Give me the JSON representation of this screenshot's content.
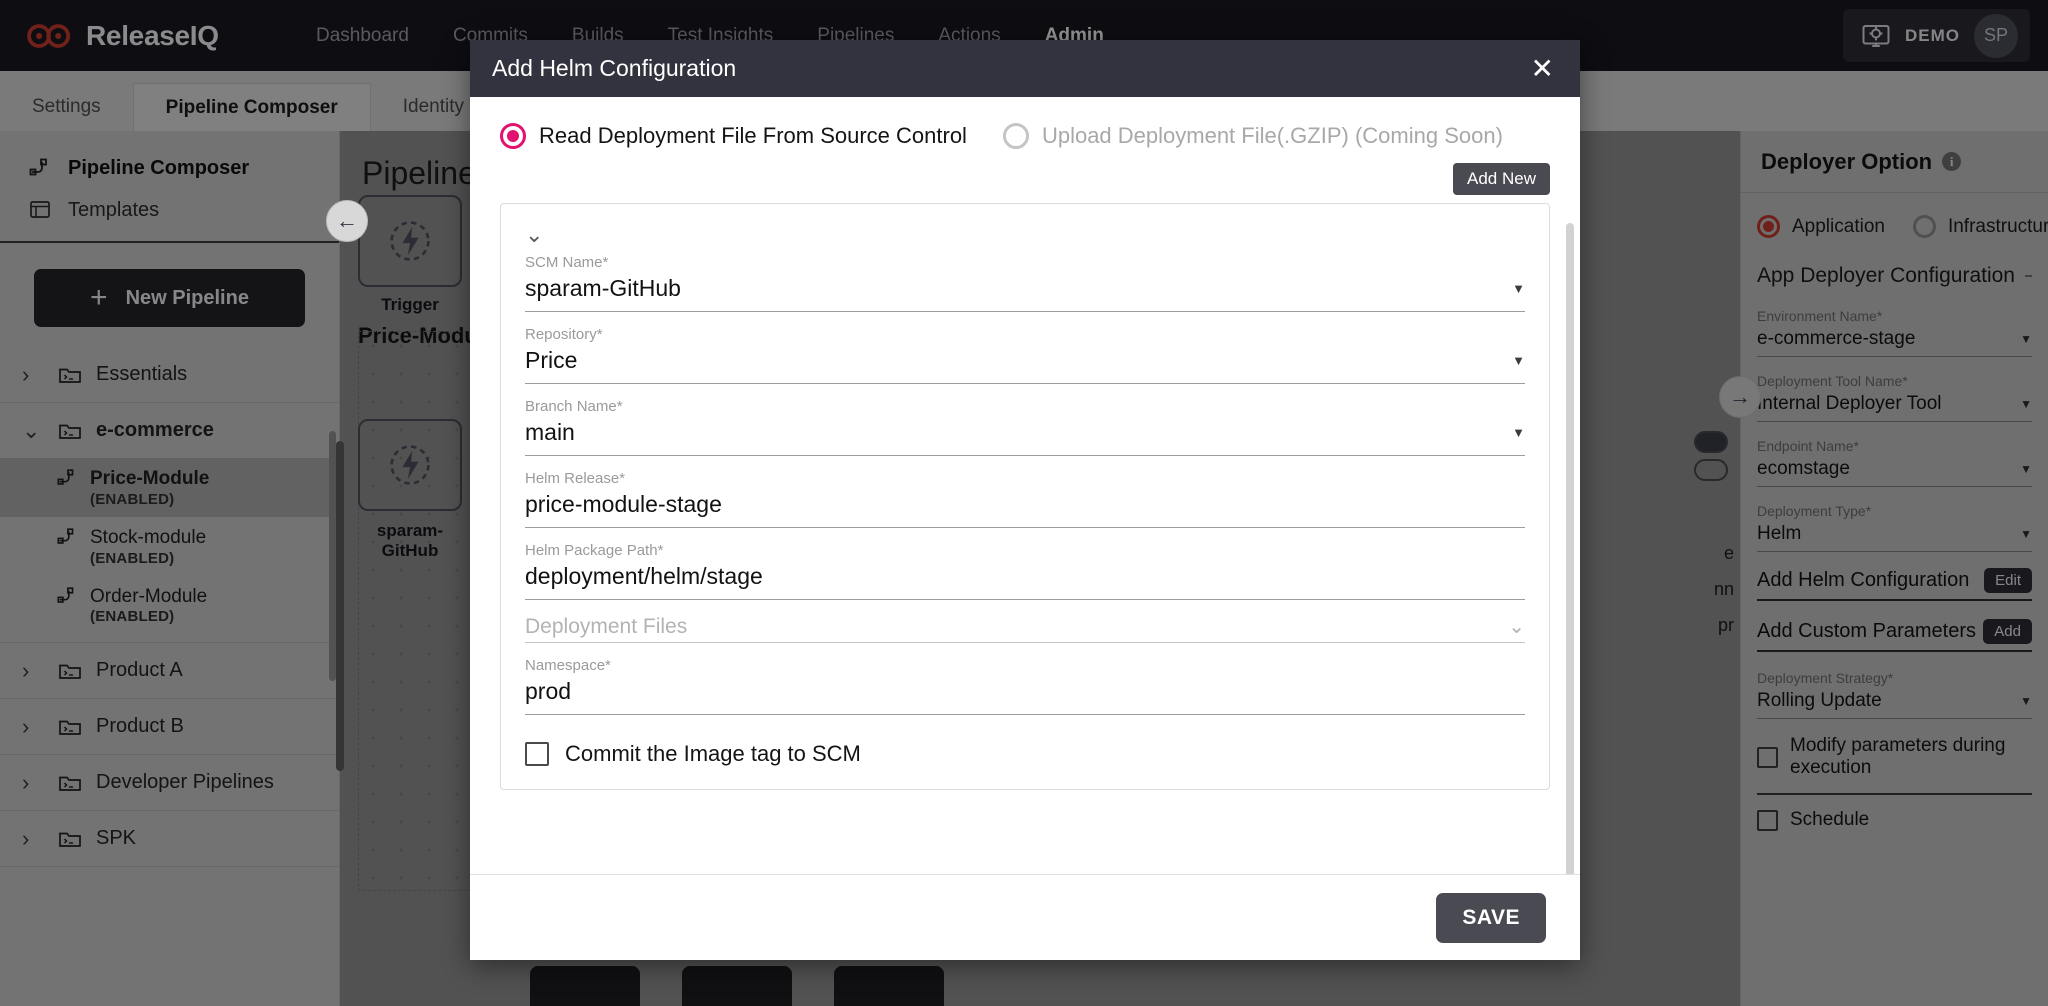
{
  "topnav": {
    "brand": "ReleaseIQ",
    "items": [
      {
        "label": "Dashboard",
        "active": false
      },
      {
        "label": "Commits",
        "active": false
      },
      {
        "label": "Builds",
        "active": false
      },
      {
        "label": "Test Insights",
        "active": false
      },
      {
        "label": "Pipelines",
        "active": false
      },
      {
        "label": "Actions",
        "active": false
      },
      {
        "label": "Admin",
        "active": true
      }
    ],
    "org_label": "DEMO",
    "avatar_initials": "SP"
  },
  "subnav": {
    "tabs": [
      {
        "label": "Settings",
        "active": false
      },
      {
        "label": "Pipeline Composer",
        "active": true
      },
      {
        "label": "Identity",
        "active": false
      }
    ]
  },
  "sidebar": {
    "head_items": [
      {
        "label": "Pipeline Composer",
        "icon": "pipeline-icon",
        "active": true
      },
      {
        "label": "Templates",
        "icon": "template-icon",
        "active": false
      }
    ],
    "new_pipeline_label": "New Pipeline",
    "tree": [
      {
        "label": "Essentials",
        "expanded": false,
        "children": []
      },
      {
        "label": "e-commerce",
        "expanded": true,
        "children": [
          {
            "name": "Price-Module",
            "state": "(ENABLED)",
            "selected": true
          },
          {
            "name": "Stock-module",
            "state": "(ENABLED)",
            "selected": false
          },
          {
            "name": "Order-Module",
            "state": "(ENABLED)",
            "selected": false
          }
        ]
      },
      {
        "label": "Product A",
        "expanded": false,
        "children": []
      },
      {
        "label": "Product B",
        "expanded": false,
        "children": []
      },
      {
        "label": "Developer Pipelines",
        "expanded": false,
        "children": []
      },
      {
        "label": "SPK",
        "expanded": false,
        "children": []
      }
    ]
  },
  "canvas": {
    "title": "Pipeline",
    "group_label": "Price-Module",
    "nodes": [
      {
        "caption": "Trigger",
        "icon": "bolt-icon"
      },
      {
        "caption": "sparam-\nGitHub",
        "icon": "bolt-icon"
      }
    ],
    "side_texts": [
      "e",
      "nn",
      "pr"
    ]
  },
  "rightpanel": {
    "title": "Deployer Option",
    "deployer_type": [
      {
        "label": "Application",
        "selected": true
      },
      {
        "label": "Infrastructure",
        "selected": false
      }
    ],
    "section_title": "App Deployer Configuration",
    "fields": [
      {
        "label": "Environment Name*",
        "value": "e-commerce-stage",
        "type": "select"
      },
      {
        "label": "Deployment Tool Name*",
        "value": "Internal Deployer Tool",
        "type": "select"
      },
      {
        "label": "Endpoint Name*",
        "value": "ecomstage",
        "type": "select"
      },
      {
        "label": "Deployment Type*",
        "value": "Helm",
        "type": "select"
      }
    ],
    "actions": [
      {
        "label": "Add Helm Configuration",
        "button": "Edit"
      },
      {
        "label": "Add Custom Parameters",
        "button": "Add"
      }
    ],
    "strategy": {
      "label": "Deployment Strategy*",
      "value": "Rolling Update",
      "type": "select"
    },
    "checkboxes": [
      {
        "label": "Modify parameters during execution",
        "checked": false
      },
      {
        "label": "Schedule",
        "checked": false
      }
    ]
  },
  "modal": {
    "title": "Add Helm Configuration",
    "close_label": "✕",
    "modes": [
      {
        "label": "Read Deployment File From Source Control",
        "selected": true,
        "disabled": false
      },
      {
        "label": "Upload Deployment File(.GZIP) (Coming Soon)",
        "selected": false,
        "disabled": true
      }
    ],
    "add_new_label": "Add New",
    "fields": [
      {
        "label": "SCM Name*",
        "value": "sparam-GitHub",
        "type": "select"
      },
      {
        "label": "Repository*",
        "value": "Price",
        "type": "select"
      },
      {
        "label": "Branch Name*",
        "value": "main",
        "type": "select"
      },
      {
        "label": "Helm Release*",
        "value": "price-module-stage",
        "type": "text"
      },
      {
        "label": "Helm Package Path*",
        "value": "deployment/helm/stage",
        "type": "text"
      },
      {
        "label": "Deployment Files",
        "value": "",
        "type": "expander"
      },
      {
        "label": "Namespace*",
        "value": "prod",
        "type": "text"
      }
    ],
    "commit_checkbox": {
      "label": "Commit the Image tag to SCM",
      "checked": false
    },
    "save_label": "SAVE"
  },
  "colors": {
    "accent_pink": "#e2136e",
    "accent_red": "#c0392b",
    "brand_red": "#c1392b",
    "header_dark": "#17171f",
    "modal_header": "#33333f"
  }
}
